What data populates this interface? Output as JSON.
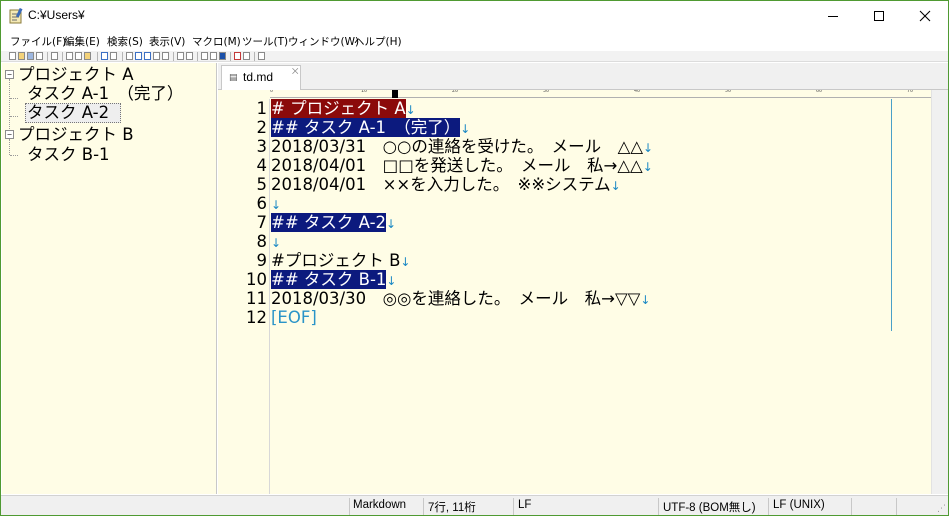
{
  "window": {
    "title": "C:¥Users¥",
    "minimize_glyph": "—",
    "maximize_glyph": "☐",
    "close_glyph": "✕"
  },
  "menu": [
    "ファイル(F)",
    "編集(E)",
    "検索(S)",
    "表示(V)",
    "マクロ(M)",
    "ツール(T)",
    "ウィンドウ(W)",
    "ヘルプ(H)"
  ],
  "outline": {
    "items": [
      {
        "label": "プロジェクト A",
        "level": 0,
        "toggle": "−"
      },
      {
        "label": "タスク A-1　（完了）",
        "level": 1
      },
      {
        "label": "タスク A-2",
        "level": 1,
        "selected": true
      },
      {
        "label": "プロジェクト B",
        "level": 0,
        "toggle": "−"
      },
      {
        "label": "タスク B-1",
        "level": 1
      }
    ]
  },
  "tab": {
    "label": "td.md",
    "close": "⨉"
  },
  "ruler": {
    "labels": [
      "0",
      "10",
      "20",
      "30",
      "40",
      "50",
      "60",
      "70"
    ]
  },
  "editor": {
    "newline_glyph": "↓",
    "lines": [
      {
        "no": "1",
        "text": "# プロジェクト A",
        "style": "red"
      },
      {
        "no": "2",
        "text": "## タスク A-1　（完了）",
        "style": "blue"
      },
      {
        "no": "3",
        "text": "2018/03/31　○○の連絡を受けた。　メール　△△",
        "style": ""
      },
      {
        "no": "4",
        "text": "2018/04/01　□□を発送した。　メール　私→△△",
        "style": ""
      },
      {
        "no": "5",
        "text": "2018/04/01　××を入力した。　※※システム",
        "style": ""
      },
      {
        "no": "6",
        "text": "",
        "style": ""
      },
      {
        "no": "7",
        "text": "## タスク A-2",
        "style": "blue"
      },
      {
        "no": "8",
        "text": "",
        "style": ""
      },
      {
        "no": "9",
        "text": "#プロジェクト B",
        "style": ""
      },
      {
        "no": "10",
        "text": "## タスク B-1",
        "style": "blue"
      },
      {
        "no": "11",
        "text": "2018/03/30　◎◎を連絡した。　メール　私→▽▽",
        "style": ""
      },
      {
        "no": "12",
        "text": "[EOF]",
        "style": "eof"
      }
    ]
  },
  "status": {
    "mode": "Markdown",
    "position": "7行, 11桁",
    "newline": "LF",
    "encoding": "UTF-8 (BOM無し)",
    "input_newline": "LF (UNIX)"
  },
  "colors": {
    "heading1_bg": "#8b0a0a",
    "heading2_bg": "#0c1a7e",
    "editor_bg": "#fffde6",
    "newline_mark": "#1a88c4"
  }
}
